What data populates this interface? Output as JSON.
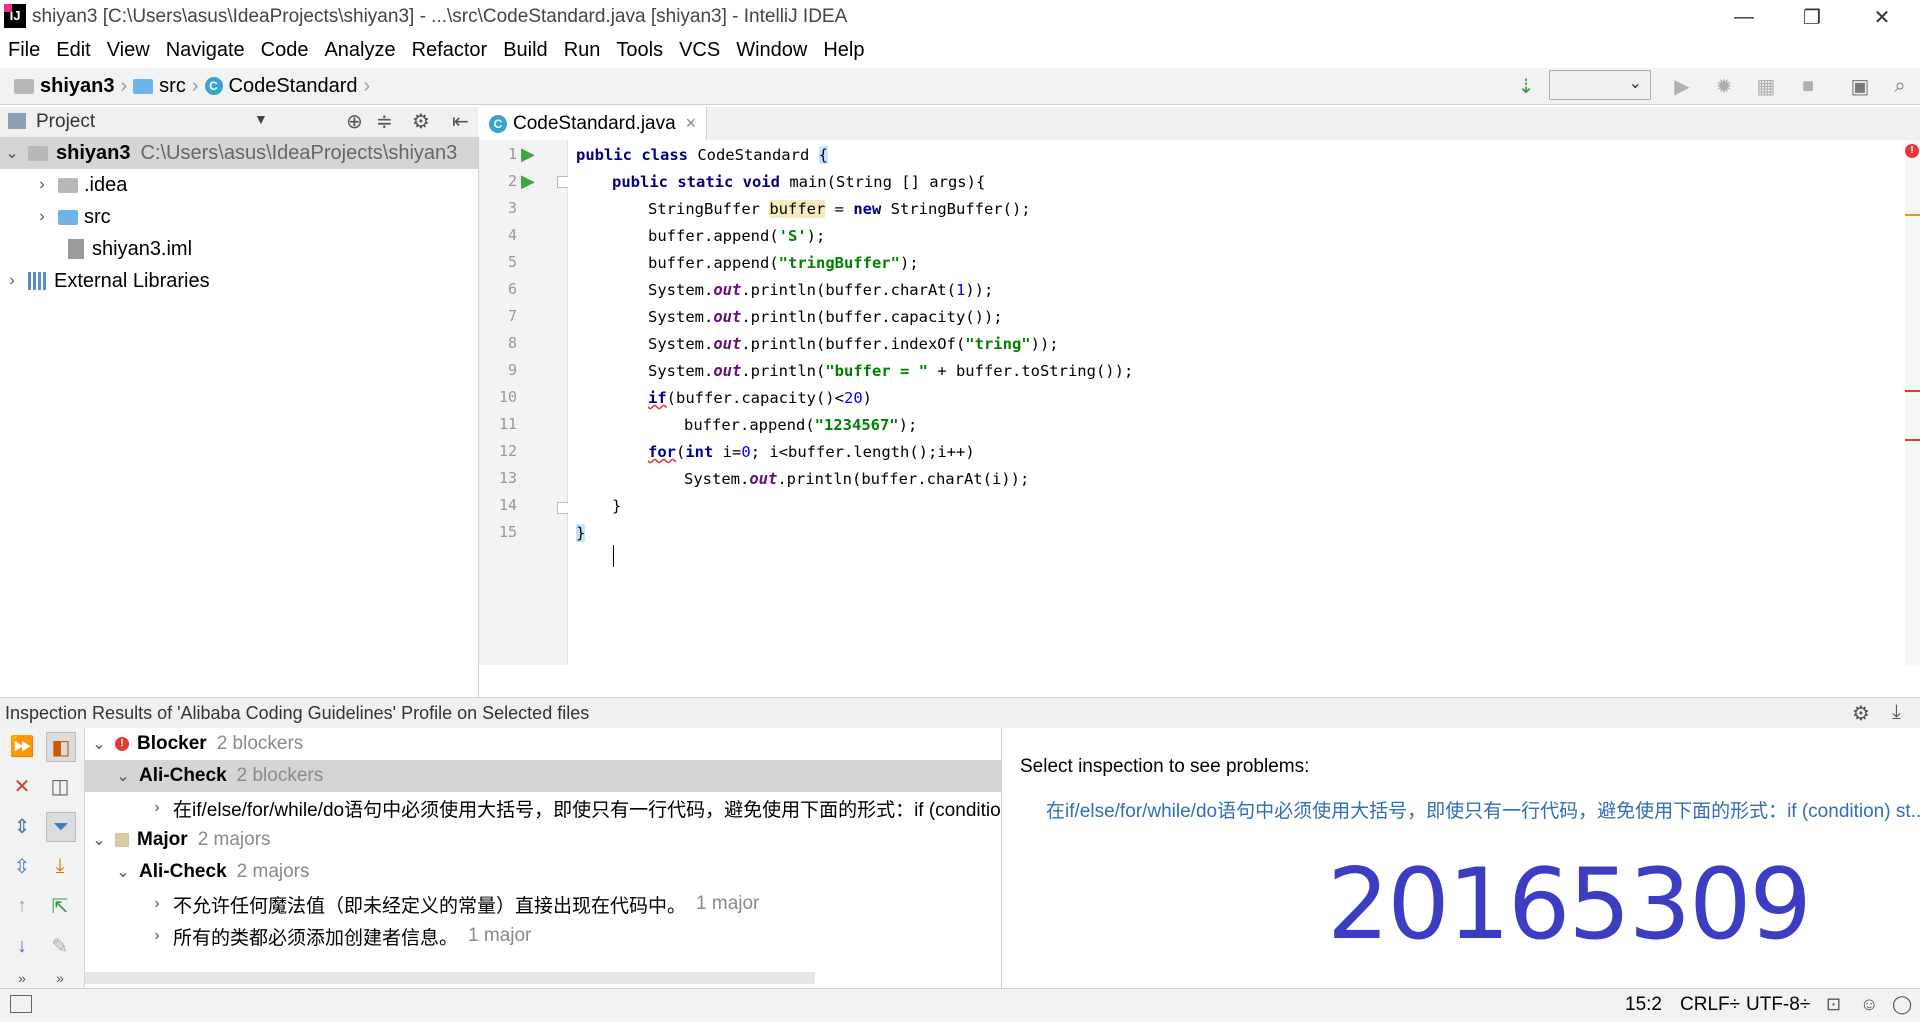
{
  "window": {
    "title": "shiyan3 [C:\\Users\\asus\\IdeaProjects\\shiyan3] - ...\\src\\CodeStandard.java [shiyan3] - IntelliJ IDEA",
    "logo": "IJ",
    "minimize": "—",
    "restore": "❐",
    "close": "✕"
  },
  "menu": [
    "File",
    "Edit",
    "View",
    "Navigate",
    "Code",
    "Analyze",
    "Refactor",
    "Build",
    "Run",
    "Tools",
    "VCS",
    "Window",
    "Help"
  ],
  "breadcrumb": {
    "project": "shiyan3",
    "folder": "src",
    "file": "CodeStandard"
  },
  "project_panel": {
    "title": "Project",
    "tree": [
      {
        "label": "shiyan3",
        "path": "C:\\Users\\asus\\IdeaProjects\\shiyan3"
      },
      {
        "label": ".idea"
      },
      {
        "label": "src"
      },
      {
        "label": "shiyan3.iml"
      },
      {
        "label": "External Libraries"
      }
    ]
  },
  "editor": {
    "tab_label": "CodeStandard.java",
    "tab_close": "×",
    "line_numbers": [
      "1",
      "2",
      "3",
      "4",
      "5",
      "6",
      "7",
      "8",
      "9",
      "10",
      "11",
      "12",
      "13",
      "14",
      "15"
    ],
    "code": {
      "l1_kw": "public class",
      "l1_rest": " CodeStandard ",
      "l1_brace": "{",
      "l2_kw": "public static void",
      "l2_rest": " main(String [] args){",
      "l3_a": "StringBuffer ",
      "l3_var": "buffer",
      "l3_b": " = ",
      "l3_kw": "new",
      "l3_c": " StringBuffer();",
      "l4_a": "buffer.append(",
      "l4_str": "'S'",
      "l4_b": ");",
      "l5_a": "buffer.append(",
      "l5_str": "\"tringBuffer\"",
      "l5_b": ");",
      "l6_a": "System.",
      "l6_out": "out",
      "l6_b": ".println(buffer.charAt(",
      "l6_num": "1",
      "l6_c": "));",
      "l7_a": "System.",
      "l7_out": "out",
      "l7_b": ".println(buffer.capacity());",
      "l8_a": "System.",
      "l8_out": "out",
      "l8_b": ".println(buffer.indexOf(",
      "l8_str": "\"tring\"",
      "l8_c": "));",
      "l9_a": "System.",
      "l9_out": "out",
      "l9_b": ".println(",
      "l9_str": "\"buffer = \"",
      "l9_c": " + buffer.toString());",
      "l10_kw": "if",
      "l10_a": "(buffer.capacity()<",
      "l10_num": "20",
      "l10_b": ")",
      "l11_a": "buffer.append(",
      "l11_str": "\"1234567\"",
      "l11_b": ");",
      "l12_kw": "for",
      "l12_a": "(",
      "l12_kw2": "int",
      "l12_b": " i=",
      "l12_num": "0",
      "l12_c": "; i<buffer.length();i++)",
      "l13_a": "System.",
      "l13_out": "out",
      "l13_b": ".println(buffer.charAt(i));",
      "l14": "}",
      "l15": "}"
    }
  },
  "inspection": {
    "header": "Inspection Results of 'Alibaba Coding Guidelines' Profile on Selected files",
    "tree": {
      "blocker": {
        "label": "Blocker",
        "count": "2 blockers"
      },
      "blocker_check": {
        "label": "Ali-Check",
        "count": "2 blockers"
      },
      "blocker_item": "在if/else/for/while/do语句中必须使用大括号，即使只有一行代码，避免使用下面的形式：if (conditio",
      "major": {
        "label": "Major",
        "count": "2 majors"
      },
      "major_check": {
        "label": "Ali-Check",
        "count": "2 majors"
      },
      "major_item1": {
        "label": "不允许任何魔法值（即未经定义的常量）直接出现在代码中。",
        "count": "1 major"
      },
      "major_item2": {
        "label": "所有的类都必须添加创建者信息。",
        "count": "1 major"
      }
    },
    "right_title": "Select inspection to see problems:",
    "right_link": "在if/else/for/while/do语句中必须使用大括号，即使只有一行代码，避免使用下面的形式：if (condition) st...",
    "stamp": "20165309"
  },
  "status": {
    "position": "15:2",
    "line_sep": "CRLF÷",
    "encoding": "UTF-8÷"
  },
  "colors": {
    "accent": "#3d3dc4",
    "error": "#e53935",
    "link": "#2f6fb8"
  }
}
